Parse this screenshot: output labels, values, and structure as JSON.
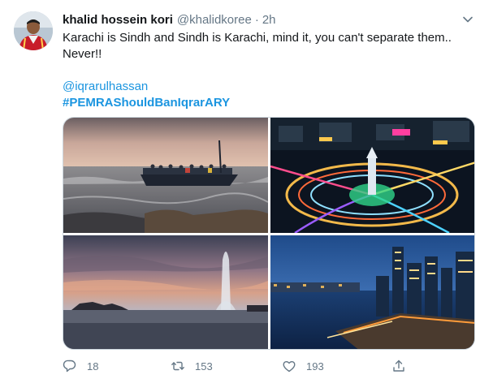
{
  "tweet": {
    "author": {
      "display_name": "khalid hossein kori",
      "handle": "@khalidkoree",
      "separator": "·",
      "time": "2h",
      "avatar_icon": "profile-photo"
    },
    "text": "Karachi is Sindh and Sindh is Karachi, mind it, you can't separate them.. Never!!",
    "mention": "@iqrarulhassan",
    "hashtag": "#PEMRAShouldBanIqrarARY",
    "media": [
      {
        "kind": "photo",
        "subject": "boat-at-sea-sunset"
      },
      {
        "kind": "photo",
        "subject": "city-roundabout-night"
      },
      {
        "kind": "photo",
        "subject": "fountain-at-dusk"
      },
      {
        "kind": "photo",
        "subject": "skyline-at-night"
      }
    ],
    "actions": {
      "reply_count": "18",
      "retweet_count": "153",
      "like_count": "193"
    },
    "colors": {
      "link": "#1b95e0",
      "secondary_text": "#657786",
      "primary_text": "#14171a"
    }
  }
}
